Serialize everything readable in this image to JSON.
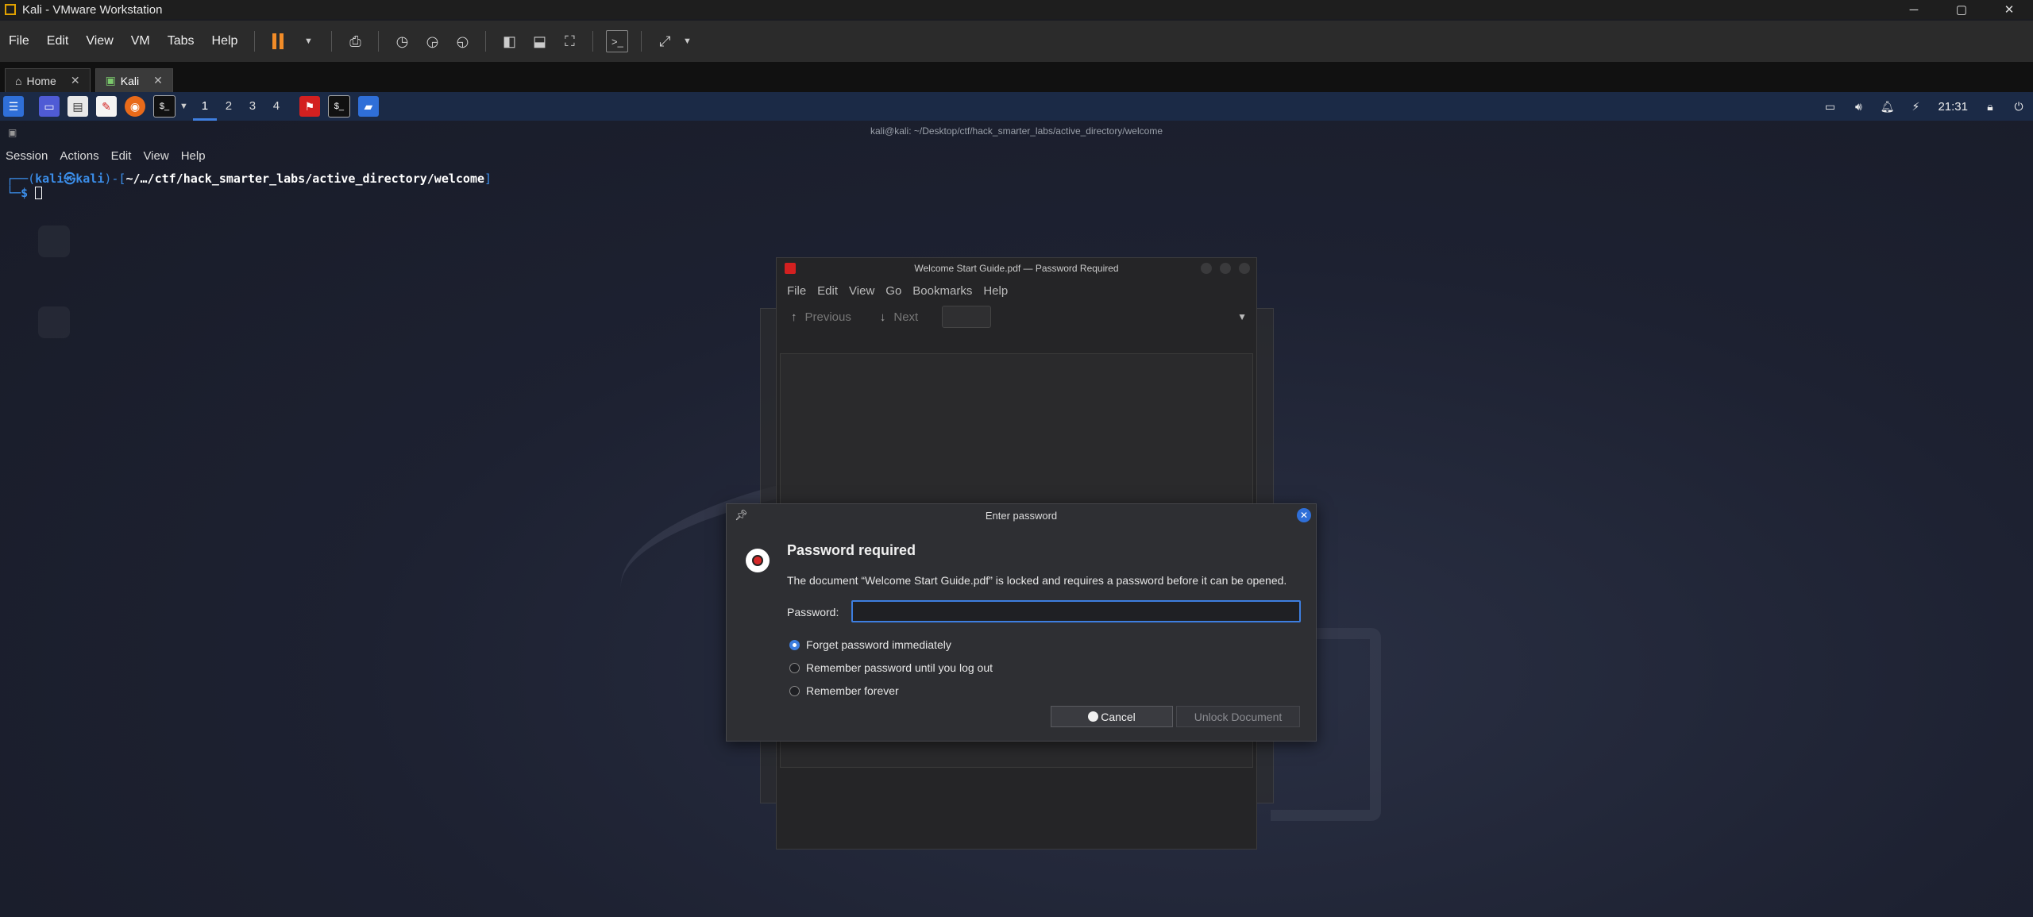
{
  "vmware": {
    "title": "Kali - VMware Workstation",
    "window_controls": {
      "minimize": "─",
      "maximize": "▢",
      "close": "✕"
    },
    "menu": [
      "File",
      "Edit",
      "View",
      "VM",
      "Tabs",
      "Help"
    ],
    "tabs": [
      {
        "label": "Home",
        "close": "✕"
      },
      {
        "label": "Kali",
        "close": "✕"
      }
    ]
  },
  "kali_panel": {
    "workspaces": [
      "1",
      "2",
      "3",
      "4"
    ],
    "active_workspace": "1",
    "clock": "21:31"
  },
  "terminal": {
    "title": "kali@kali: ~/Desktop/ctf/hack_smarter_labs/active_directory/welcome",
    "menu": [
      "Session",
      "Actions",
      "Edit",
      "View",
      "Help"
    ],
    "prompt_open": "┌──(",
    "prompt_user": "kali㉿kali",
    "prompt_mid": ")-[",
    "prompt_path": "~/…/ctf/hack_smarter_labs/active_directory/welcome",
    "prompt_close": "]",
    "prompt_line2": "└─",
    "prompt_dollar": "$ "
  },
  "evince": {
    "title": "Welcome Start Guide.pdf — Password Required",
    "menu": [
      "File",
      "Edit",
      "View",
      "Go",
      "Bookmarks",
      "Help"
    ],
    "previous_label": "Previous",
    "next_label": "Next"
  },
  "dialog": {
    "title": "Enter password",
    "heading": "Password required",
    "message": "The document “Welcome Start Guide.pdf” is locked and requires a password before it can be opened.",
    "password_label": "Password:",
    "password_value": "",
    "options": [
      {
        "label": "Forget password immediately",
        "selected": true
      },
      {
        "label": "Remember password until you log out",
        "selected": false
      },
      {
        "label": "Remember forever",
        "selected": false
      }
    ],
    "cancel_label": "Cancel",
    "unlock_label": "Unlock Document"
  },
  "colors": {
    "accent": "#3d7ee0",
    "panel": "#1b2a46",
    "pause": "#f28c28",
    "pdf_red": "#d32020"
  }
}
